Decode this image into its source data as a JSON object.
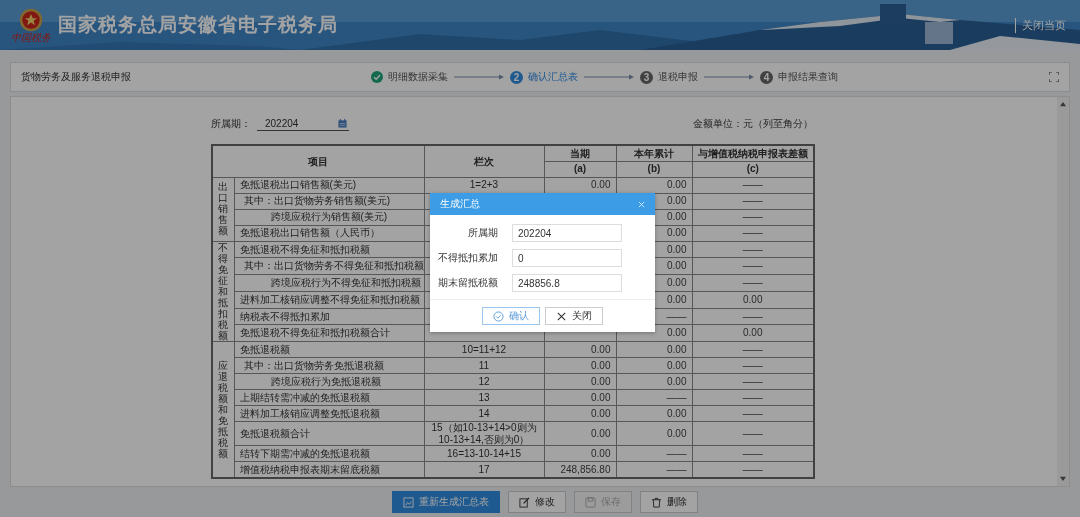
{
  "header": {
    "title": "国家税务总局安徽省电子税务局",
    "logo_text": "中国税务",
    "links": [
      "关闭当页"
    ]
  },
  "page_title": "货物劳务及服务退税申报",
  "steps": [
    {
      "label": "明细数据采集",
      "done": true,
      "selected": false
    },
    {
      "number": "2",
      "label": "确认汇总表",
      "done": false,
      "selected": true
    },
    {
      "number": "3",
      "label": "退税申报",
      "done": false,
      "selected": false
    },
    {
      "number": "4",
      "label": "申报结果查询",
      "done": false,
      "selected": false
    }
  ],
  "form": {
    "period_label": "所属期：",
    "period_value": "202204",
    "unit": "金额单位：元（列至角分）"
  },
  "table": {
    "columns": [
      "项目",
      "栏次",
      "当期",
      "本年累计",
      "与增值税纳税申报表差额"
    ],
    "subcolumns": [
      "(a)",
      "(b)",
      "(c)"
    ],
    "groups": [
      {
        "label": "出口销售额",
        "rows": [
          {
            "item": "免抵退税出口销售额(美元)",
            "kind": "main",
            "line": "1=2+3",
            "current": "0.00",
            "ytd": "0.00",
            "diff": "——"
          },
          {
            "item": "其中：出口货物劳务销售额(美元)",
            "kind": "of-which",
            "line": null,
            "current": null,
            "ytd": "0.00",
            "diff": "——"
          },
          {
            "item": "跨境应税行为销售额(美元)",
            "kind": "detail",
            "line": null,
            "current": null,
            "ytd": "0.00",
            "diff": "——"
          },
          {
            "item": "免抵退税出口销售额（人民币）",
            "kind": "main",
            "line": null,
            "current": null,
            "ytd": "0.00",
            "diff": "——"
          }
        ]
      },
      {
        "label": "不得免征和抵扣税额",
        "rows": [
          {
            "item": "免抵退税不得免征和抵扣税额",
            "kind": "main",
            "line": null,
            "current": null,
            "ytd": "0.00",
            "diff": "——"
          },
          {
            "item": "其中：出口货物劳务不得免征和抵扣税额",
            "kind": "of-which",
            "line": null,
            "current": null,
            "ytd": "0.00",
            "diff": "——"
          },
          {
            "item": "跨境应税行为不得免征和抵扣税额",
            "kind": "detail",
            "line": null,
            "current": null,
            "ytd": "0.00",
            "diff": "——"
          },
          {
            "item": "进料加工核销应调整不得免征和抵扣税额",
            "kind": "main",
            "line": null,
            "current": null,
            "ytd": "0.00",
            "diff": "0.00"
          },
          {
            "item": "纳税表不得抵扣累加",
            "kind": "main",
            "line": null,
            "current": null,
            "ytd": "——",
            "diff": "——"
          },
          {
            "item": "免抵退税不得免征和抵扣税额合计",
            "kind": "main",
            "line": null,
            "current": null,
            "ytd": "0.00",
            "diff": "0.00"
          }
        ]
      },
      {
        "label": "应退税额和免抵税额",
        "rows": [
          {
            "item": "免抵退税额",
            "kind": "main",
            "line": "10=11+12",
            "current": "0.00",
            "ytd": "0.00",
            "diff": "——"
          },
          {
            "item": "其中：出口货物劳务免抵退税额",
            "kind": "of-which",
            "line": "11",
            "current": "0.00",
            "ytd": "0.00",
            "diff": "——"
          },
          {
            "item": "跨境应税行为免抵退税额",
            "kind": "detail",
            "line": "12",
            "current": "0.00",
            "ytd": "0.00",
            "diff": "——"
          },
          {
            "item": "上期结转需冲减的免抵退税额",
            "kind": "main",
            "line": "13",
            "current": "0.00",
            "ytd": "——",
            "diff": "——"
          },
          {
            "item": "进料加工核销应调整免抵退税额",
            "kind": "main",
            "line": "14",
            "current": "0.00",
            "ytd": "0.00",
            "diff": "——"
          },
          {
            "item": "免抵退税额合计",
            "kind": "main",
            "line": "15（如10-13+14>0则为\n10-13+14,否则为0）",
            "current": "0.00",
            "ytd": "0.00",
            "diff": "——"
          },
          {
            "item": "结转下期需冲减的免抵退税额",
            "kind": "main",
            "line": "16=13-10-14+15",
            "current": "0.00",
            "ytd": "——",
            "diff": "——"
          },
          {
            "item": "增值税纳税申报表期末留底税额",
            "kind": "main",
            "line": "17",
            "current": "248,856.80",
            "ytd": "——",
            "diff": "——"
          }
        ]
      }
    ]
  },
  "dialog": {
    "title": "生成汇总",
    "fields": [
      {
        "label": "所属期",
        "value": "202204"
      },
      {
        "label": "不得抵扣累加",
        "value": "0"
      },
      {
        "label": "期末留抵税额",
        "value": "248856.8"
      }
    ],
    "buttons": [
      {
        "label": "确认",
        "kind": "confirm"
      },
      {
        "label": "关闭",
        "kind": "close"
      }
    ]
  },
  "toolbar": [
    {
      "label": "重新生成汇总表",
      "kind": "primary",
      "disabled": false
    },
    {
      "label": "修改",
      "kind": "default",
      "disabled": false
    },
    {
      "label": "保存",
      "kind": "default",
      "disabled": true
    },
    {
      "label": "删除",
      "kind": "default",
      "disabled": false
    }
  ]
}
